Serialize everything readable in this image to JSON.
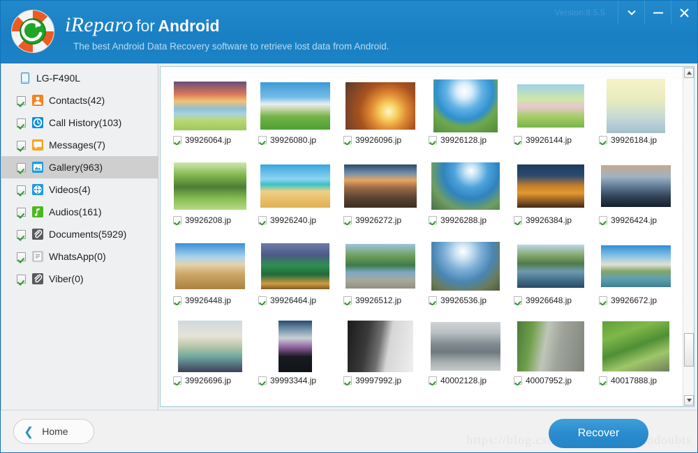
{
  "window": {
    "version_label": "Version:8.5.5",
    "controls": [
      {
        "name": "dropdown",
        "glyph": "chevron-down"
      },
      {
        "name": "minimize",
        "glyph": "minus"
      },
      {
        "name": "close",
        "glyph": "cross"
      }
    ]
  },
  "header": {
    "brand_name": "iReparo",
    "brand_for": "for",
    "brand_platform": "Android",
    "tagline": "The best Android Data Recovery software to retrieve lost data from Android.",
    "accent_color": "#1c82c6",
    "logo_icon": "lifebuoy-recovery-icon"
  },
  "sidebar": {
    "device": {
      "label": "LG-F490L",
      "icon": "phone-icon"
    },
    "items": [
      {
        "label": "Contacts(42)",
        "icon": "contacts-icon",
        "icon_color": "#f58220",
        "checked": true,
        "selected": false
      },
      {
        "label": "Call History(103)",
        "icon": "clock-icon",
        "icon_color": "#0f8ddb",
        "checked": true,
        "selected": false
      },
      {
        "label": "Messages(7)",
        "icon": "message-bubble-icon",
        "icon_color": "#f5a623",
        "checked": true,
        "selected": false
      },
      {
        "label": "Gallery(963)",
        "icon": "gallery-image-icon",
        "icon_color": "#1f9ae0",
        "checked": true,
        "selected": true
      },
      {
        "label": "Videos(4)",
        "icon": "video-reel-icon",
        "icon_color": "#1f9ae0",
        "checked": true,
        "selected": false
      },
      {
        "label": "Audios(161)",
        "icon": "music-note-icon",
        "icon_color": "#4cb820",
        "checked": true,
        "selected": false
      },
      {
        "label": "Documents(5929)",
        "icon": "document-clip-icon",
        "icon_color": "#5a5a5a",
        "checked": true,
        "selected": false
      },
      {
        "label": "WhatsApp(0)",
        "icon": "whatsapp-doc-icon",
        "icon_color": "#c9c9c9",
        "checked": true,
        "selected": false
      },
      {
        "label": "Viber(0)",
        "icon": "viber-clip-icon",
        "icon_color": "#5a5a5a",
        "checked": true,
        "selected": false
      }
    ]
  },
  "gallery": {
    "items": [
      {
        "filename": "39926064.jp",
        "checked": true,
        "thumb": "sunset-lone-tree",
        "w": 104,
        "h": 70
      },
      {
        "filename": "39926080.jp",
        "checked": true,
        "thumb": "green-field-clouds",
        "w": 100,
        "h": 68
      },
      {
        "filename": "39926096.jp",
        "checked": true,
        "thumb": "golden-sunset-field",
        "w": 100,
        "h": 68
      },
      {
        "filename": "39926128.jp",
        "checked": true,
        "thumb": "sun-over-river",
        "w": 92,
        "h": 76
      },
      {
        "filename": "39926144.jp",
        "checked": true,
        "thumb": "blossom-path-painting",
        "w": 96,
        "h": 62
      },
      {
        "filename": "39926184.jp",
        "checked": true,
        "thumb": "friends-life-quote-dock",
        "w": 84,
        "h": 78
      },
      {
        "filename": "39926208.jp",
        "checked": true,
        "thumb": "big-tree-meadow",
        "w": 104,
        "h": 68
      },
      {
        "filename": "39926240.jp",
        "checked": true,
        "thumb": "tropical-beach-palm",
        "w": 100,
        "h": 62
      },
      {
        "filename": "39926272.jp",
        "checked": true,
        "thumb": "wooden-pier-sunset",
        "w": 104,
        "h": 62
      },
      {
        "filename": "39926288.jp",
        "checked": true,
        "thumb": "person-pole-wetland",
        "w": 98,
        "h": 68
      },
      {
        "filename": "39926384.jp",
        "checked": true,
        "thumb": "amsterdam-canal-night",
        "w": 96,
        "h": 62
      },
      {
        "filename": "39926424.jp",
        "checked": true,
        "thumb": "london-skyline-eye",
        "w": 100,
        "h": 60
      },
      {
        "filename": "39926448.jp",
        "checked": true,
        "thumb": "desert-motorbike",
        "w": 100,
        "h": 66
      },
      {
        "filename": "39926464.jp",
        "checked": true,
        "thumb": "christmas-tree-city",
        "w": 98,
        "h": 66
      },
      {
        "filename": "39926512.jp",
        "checked": true,
        "thumb": "river-valley-cliff",
        "w": 100,
        "h": 64
      },
      {
        "filename": "39926536.jp",
        "checked": true,
        "thumb": "hikers-high-five",
        "w": 98,
        "h": 70
      },
      {
        "filename": "39926648.jp",
        "checked": true,
        "thumb": "yosemite-reflection",
        "w": 96,
        "h": 62
      },
      {
        "filename": "39926672.jp",
        "checked": true,
        "thumb": "taj-mahal-wide",
        "w": 100,
        "h": 60
      },
      {
        "filename": "39926696.jp",
        "checked": true,
        "thumb": "taj-mahal-captioned",
        "w": 92,
        "h": 74
      },
      {
        "filename": "39993344.jp",
        "checked": true,
        "thumb": "desktop-screenshot-dark",
        "w": 48,
        "h": 74
      },
      {
        "filename": "39997992.jp",
        "checked": true,
        "thumb": "keyboard-closeup-bw",
        "w": 94,
        "h": 74
      },
      {
        "filename": "40002128.jp",
        "checked": true,
        "thumb": "station-building-grey",
        "w": 100,
        "h": 70
      },
      {
        "filename": "40007952.jp",
        "checked": true,
        "thumb": "stone-wall-path",
        "w": 96,
        "h": 72
      },
      {
        "filename": "40017888.jp",
        "checked": true,
        "thumb": "green-foliage-wall",
        "w": 96,
        "h": 72
      }
    ]
  },
  "footer": {
    "home_label": "Home",
    "recover_label": "Recover",
    "watermark": "https://blog.csdn.net/somehownodoubts"
  }
}
